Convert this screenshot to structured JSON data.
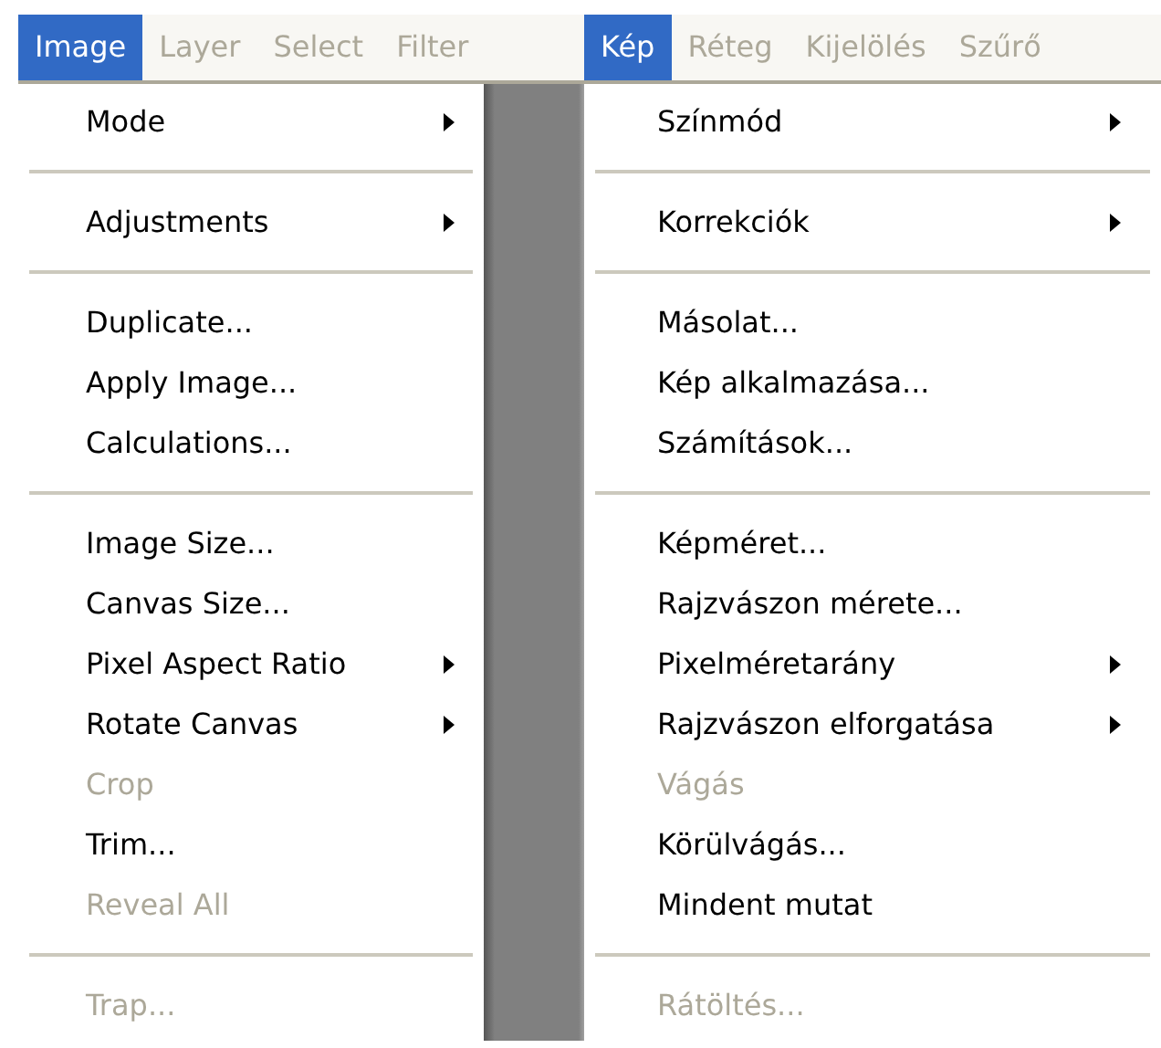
{
  "panels": [
    {
      "menubar": [
        {
          "label": "Image",
          "selected": true
        },
        {
          "label": "Layer",
          "selected": false
        },
        {
          "label": "Select",
          "selected": false
        },
        {
          "label": "Filter",
          "selected": false
        }
      ],
      "items": [
        {
          "kind": "item",
          "label": "Mode",
          "disabled": false,
          "submenu": true
        },
        {
          "kind": "separator"
        },
        {
          "kind": "item",
          "label": "Adjustments",
          "disabled": false,
          "submenu": true
        },
        {
          "kind": "separator"
        },
        {
          "kind": "item",
          "label": "Duplicate...",
          "disabled": false,
          "submenu": false
        },
        {
          "kind": "item",
          "label": "Apply Image...",
          "disabled": false,
          "submenu": false
        },
        {
          "kind": "item",
          "label": "Calculations...",
          "disabled": false,
          "submenu": false
        },
        {
          "kind": "separator"
        },
        {
          "kind": "item",
          "label": "Image Size...",
          "disabled": false,
          "submenu": false
        },
        {
          "kind": "item",
          "label": "Canvas Size...",
          "disabled": false,
          "submenu": false
        },
        {
          "kind": "item",
          "label": "Pixel Aspect Ratio",
          "disabled": false,
          "submenu": true
        },
        {
          "kind": "item",
          "label": "Rotate Canvas",
          "disabled": false,
          "submenu": true
        },
        {
          "kind": "item",
          "label": "Crop",
          "disabled": true,
          "submenu": false
        },
        {
          "kind": "item",
          "label": "Trim...",
          "disabled": false,
          "submenu": false
        },
        {
          "kind": "item",
          "label": "Reveal All",
          "disabled": true,
          "submenu": false
        },
        {
          "kind": "separator"
        },
        {
          "kind": "item",
          "label": "Trap...",
          "disabled": true,
          "submenu": false
        }
      ]
    },
    {
      "menubar": [
        {
          "label": "Kép",
          "selected": true
        },
        {
          "label": "Réteg",
          "selected": false
        },
        {
          "label": "Kijelölés",
          "selected": false
        },
        {
          "label": "Szűrő",
          "selected": false
        }
      ],
      "items": [
        {
          "kind": "item",
          "label": "Színmód",
          "disabled": false,
          "submenu": true
        },
        {
          "kind": "separator"
        },
        {
          "kind": "item",
          "label": "Korrekciók",
          "disabled": false,
          "submenu": true
        },
        {
          "kind": "separator"
        },
        {
          "kind": "item",
          "label": "Másolat...",
          "disabled": false,
          "submenu": false
        },
        {
          "kind": "item",
          "label": "Kép alkalmazása...",
          "disabled": false,
          "submenu": false
        },
        {
          "kind": "item",
          "label": "Számítások...",
          "disabled": false,
          "submenu": false
        },
        {
          "kind": "separator"
        },
        {
          "kind": "item",
          "label": "Képméret...",
          "disabled": false,
          "submenu": false
        },
        {
          "kind": "item",
          "label": "Rajzvászon mérete...",
          "disabled": false,
          "submenu": false
        },
        {
          "kind": "item",
          "label": "Pixelméretarány",
          "disabled": false,
          "submenu": true
        },
        {
          "kind": "item",
          "label": "Rajzvászon elforgatása",
          "disabled": false,
          "submenu": true
        },
        {
          "kind": "item",
          "label": "Vágás",
          "disabled": true,
          "submenu": false
        },
        {
          "kind": "item",
          "label": "Körülvágás...",
          "disabled": false,
          "submenu": false
        },
        {
          "kind": "item",
          "label": "Mindent mutat",
          "disabled": false,
          "submenu": false
        },
        {
          "kind": "separator"
        },
        {
          "kind": "item",
          "label": "Rátöltés...",
          "disabled": true,
          "submenu": false
        }
      ]
    }
  ]
}
